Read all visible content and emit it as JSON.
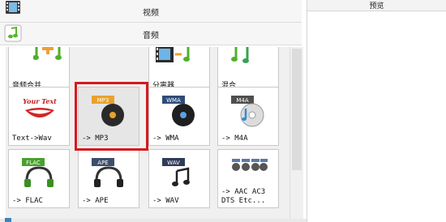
{
  "categories": {
    "video": {
      "label": "视频",
      "icon": "film-icon"
    },
    "audio": {
      "label": "音频",
      "icon": "music-note-icon"
    }
  },
  "tiles": {
    "merge": {
      "label": "音频合并",
      "icon": "audio-merge-icon"
    },
    "splitter": {
      "label": "分离器",
      "icon": "audio-splitter-icon"
    },
    "mix": {
      "label": "混合",
      "icon": "audio-mix-icon"
    },
    "text_to_wav": {
      "label": "Text->Wav",
      "icon": "your-text-lips-icon",
      "badge": "Your Text"
    },
    "mp3": {
      "label": "-> MP3",
      "icon": "mp3-disc-icon",
      "badge": "MP3",
      "selected": true
    },
    "wma": {
      "label": "-> WMA",
      "icon": "wma-disc-icon",
      "badge": "WMA"
    },
    "m4a": {
      "label": "-> M4A",
      "icon": "m4a-disc-icon",
      "badge": "M4A"
    },
    "flac": {
      "label": "-> FLAC",
      "icon": "flac-headphones-icon",
      "badge": "FLAC"
    },
    "ape": {
      "label": "-> APE",
      "icon": "ape-headphones-icon",
      "badge": "APE"
    },
    "wav": {
      "label": "-> WAV",
      "icon": "wav-music-note-icon",
      "badge": "WAV"
    },
    "aac_ac3_dts": {
      "label": "-> AAC AC3\nDTS Etc...",
      "icon": "multi-format-icon"
    }
  },
  "preview": {
    "label": "预览"
  },
  "colors": {
    "selection": "#d7191c",
    "accent": "#3a84c4"
  }
}
